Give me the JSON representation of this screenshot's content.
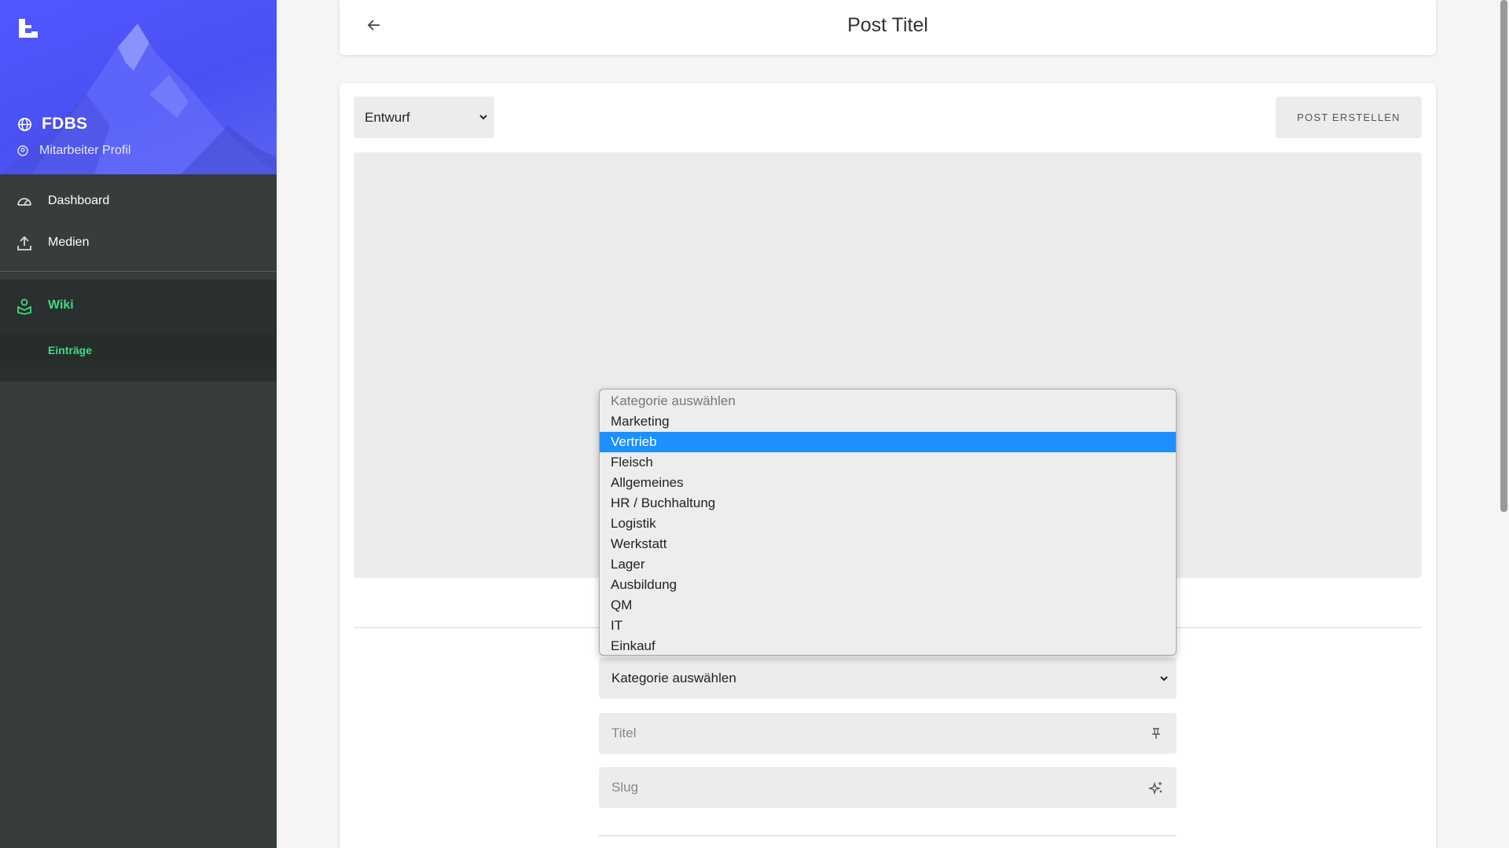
{
  "sidebar": {
    "brand": "FDBS",
    "profile": "Mitarbeiter Profil",
    "items": [
      {
        "label": "Dashboard",
        "icon": "speedometer-icon"
      },
      {
        "label": "Medien",
        "icon": "upload-icon"
      }
    ],
    "wiki": {
      "label": "Wiki",
      "icon": "wiki-icon",
      "sub_label": "Einträge"
    },
    "accent_color": "#3ddc84",
    "header_color": "#5158ff"
  },
  "header": {
    "title": "Post Titel"
  },
  "editor": {
    "status_value": "Entwurf",
    "create_button": "POST ERSTELLEN",
    "category_value": "Kategorie auswählen",
    "title_placeholder": "Titel",
    "slug_placeholder": "Slug"
  },
  "dropdown": {
    "options": [
      "Kategorie auswählen",
      "Marketing",
      "Vertrieb",
      "Fleisch",
      "Allgemeines",
      "HR / Buchhaltung",
      "Logistik",
      "Werkstatt",
      "Lager",
      "Ausbildung",
      "QM",
      "IT",
      "Einkauf"
    ],
    "selected": "Vertrieb",
    "highlight_color": "#1e8fff"
  }
}
